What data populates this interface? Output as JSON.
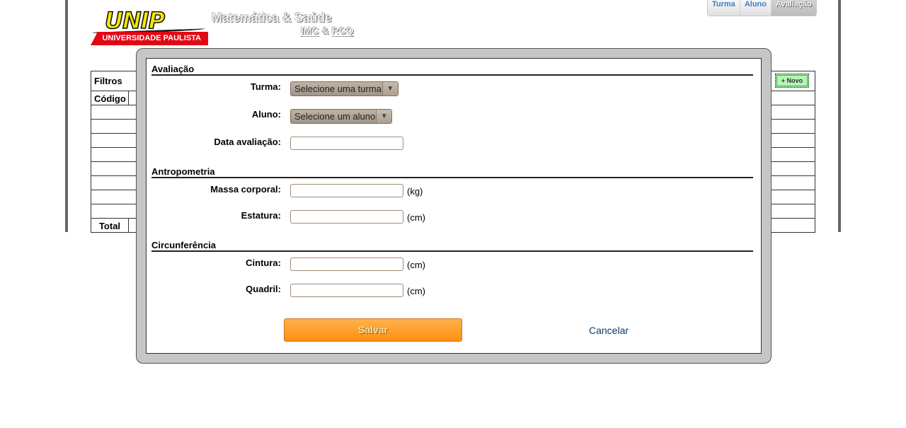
{
  "header": {
    "logo_word": "UNIP",
    "logo_band": "UNIVERSIDADE PAULISTA",
    "app_title": "Matemática & Saúde",
    "link_imc": "IMC",
    "link_separator": "&",
    "link_rcq": "RCQ"
  },
  "tabs": [
    {
      "label": "Turma",
      "active": false
    },
    {
      "label": "Aluno",
      "active": false
    },
    {
      "label": "Avaliação",
      "active": true
    }
  ],
  "grid": {
    "filters_label": "Filtros",
    "new_button_label": "+ Novo",
    "column_header": "Código",
    "footer_label": "Total"
  },
  "form": {
    "section_avaliacao": "Avaliação",
    "turma_label": "Turma:",
    "turma_value": "Selecione uma turma",
    "aluno_label": "Aluno:",
    "aluno_value": "Selecione um aluno",
    "data_label": "Data avaliação:",
    "data_value": "",
    "section_antropometria": "Antropometria",
    "massa_label": "Massa corporal:",
    "massa_value": "",
    "massa_unit": "(kg)",
    "estatura_label": "Estatura:",
    "estatura_value": "",
    "estatura_unit": "(cm)",
    "section_circunferencia": "Circunferência",
    "cintura_label": "Cintura:",
    "cintura_value": "",
    "cintura_unit": "(cm)",
    "quadril_label": "Quadril:",
    "quadril_value": "",
    "quadril_unit": "(cm)",
    "save_label": "Salvar",
    "cancel_label": "Cancelar"
  },
  "colors": {
    "save_button": "#ff9a20",
    "modal_border": "#c6c6c6",
    "logo_yellow": "#f6e600",
    "logo_red": "#e30613",
    "cancel_link": "#0c3a66"
  }
}
